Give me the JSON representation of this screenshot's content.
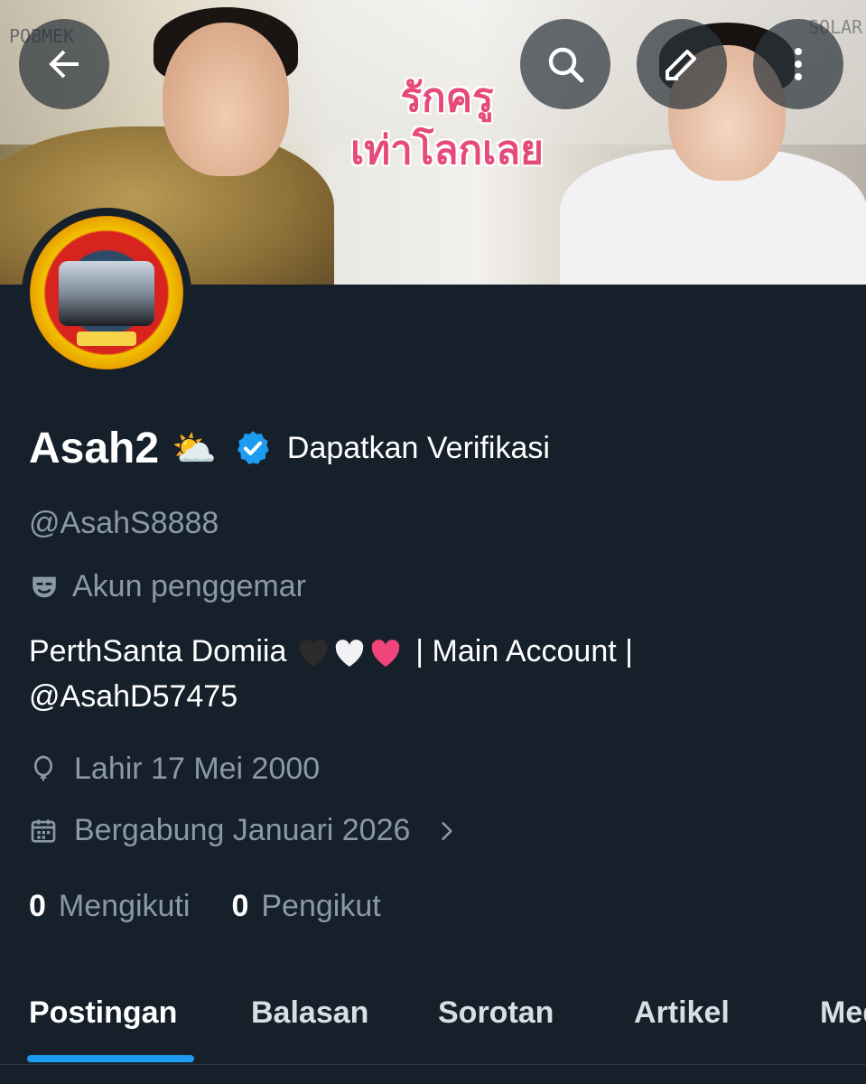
{
  "banner": {
    "title_art_line1": "รักครู",
    "title_art_line2": "เท่าโลกเลย",
    "watermark_left": "POBMEK",
    "watermark_right": "SOLAR"
  },
  "header": {
    "back_icon": "arrow-left-icon",
    "search_icon": "search-icon",
    "edit_icon": "pencil-icon",
    "more_icon": "more-vertical-icon"
  },
  "profile": {
    "name": "Asah2",
    "name_emoji": "⛅",
    "get_verified_label": "Dapatkan Verifikasi",
    "handle": "@AsahS8888",
    "category": "Akun penggemar",
    "bio_text": "PerthSanta Domiia",
    "bio_suffix": "| Main Account |",
    "bio_mention": "@AsahD57475",
    "birth": "Lahir 17 Mei 2000",
    "joined": "Bergabung Januari 2026",
    "following_count": "0",
    "following_label": "Mengikuti",
    "followers_count": "0",
    "followers_label": "Pengikut",
    "verified_color": "#1d9bf0"
  },
  "tabs": [
    {
      "label": "Postingan",
      "active": true
    },
    {
      "label": "Balasan",
      "active": false
    },
    {
      "label": "Sorotan",
      "active": false
    },
    {
      "label": "Artikel",
      "active": false
    },
    {
      "label": "Media",
      "active": false
    }
  ],
  "colors": {
    "background": "#15202b",
    "accent": "#1d9bf0",
    "muted_text": "#8b98a5"
  }
}
